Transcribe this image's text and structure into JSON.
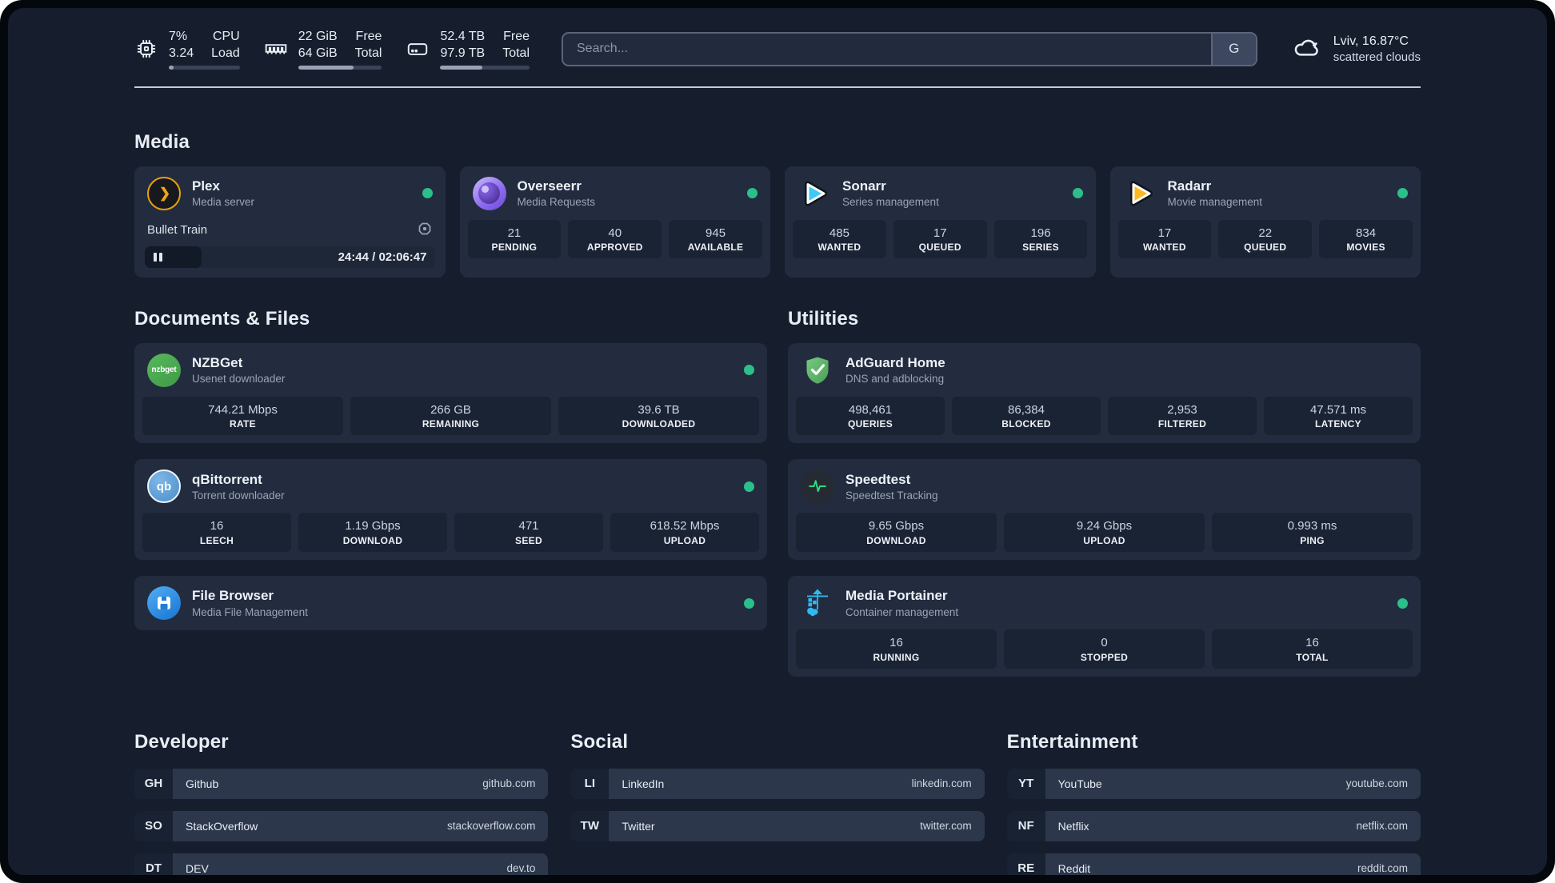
{
  "header": {
    "widgets": [
      {
        "values": [
          "7%",
          "3.24"
        ],
        "labels": [
          "CPU",
          "Load"
        ],
        "progress_pct": 7
      },
      {
        "values": [
          "22 GiB",
          "64 GiB"
        ],
        "labels": [
          "Free",
          "Total"
        ],
        "progress_pct": 66
      },
      {
        "values": [
          "52.4 TB",
          "97.9 TB"
        ],
        "labels": [
          "Free",
          "Total"
        ],
        "progress_pct": 47
      }
    ],
    "search": {
      "placeholder": "Search...",
      "provider_button": "G"
    },
    "weather": {
      "title": "Lviv, 16.87°C",
      "subtitle": "scattered clouds"
    }
  },
  "sections": {
    "media": {
      "title": "Media",
      "cards": {
        "plex": {
          "title": "Plex",
          "subtitle": "Media server",
          "online": true,
          "now_playing": {
            "title": "Bullet Train",
            "time": "24:44 / 02:06:47",
            "progress_pct": 19.5
          }
        },
        "overseerr": {
          "title": "Overseerr",
          "subtitle": "Media Requests",
          "online": true,
          "stats": [
            {
              "value": "21",
              "label": "PENDING"
            },
            {
              "value": "40",
              "label": "APPROVED"
            },
            {
              "value": "945",
              "label": "AVAILABLE"
            }
          ]
        },
        "sonarr": {
          "title": "Sonarr",
          "subtitle": "Series management",
          "online": true,
          "stats": [
            {
              "value": "485",
              "label": "WANTED"
            },
            {
              "value": "17",
              "label": "QUEUED"
            },
            {
              "value": "196",
              "label": "SERIES"
            }
          ]
        },
        "radarr": {
          "title": "Radarr",
          "subtitle": "Movie management",
          "online": true,
          "stats": [
            {
              "value": "17",
              "label": "WANTED"
            },
            {
              "value": "22",
              "label": "QUEUED"
            },
            {
              "value": "834",
              "label": "MOVIES"
            }
          ]
        }
      }
    },
    "documents": {
      "title": "Documents & Files",
      "cards": {
        "nzbget": {
          "title": "NZBGet",
          "subtitle": "Usenet downloader",
          "online": true,
          "stats": [
            {
              "value": "744.21 Mbps",
              "label": "RATE"
            },
            {
              "value": "266 GB",
              "label": "REMAINING"
            },
            {
              "value": "39.6 TB",
              "label": "DOWNLOADED"
            }
          ]
        },
        "qbittorrent": {
          "title": "qBittorrent",
          "subtitle": "Torrent downloader",
          "online": true,
          "stats": [
            {
              "value": "16",
              "label": "LEECH"
            },
            {
              "value": "1.19 Gbps",
              "label": "DOWNLOAD"
            },
            {
              "value": "471",
              "label": "SEED"
            },
            {
              "value": "618.52 Mbps",
              "label": "UPLOAD"
            }
          ]
        },
        "filebrowser": {
          "title": "File Browser",
          "subtitle": "Media File Management",
          "online": true
        }
      }
    },
    "utilities": {
      "title": "Utilities",
      "cards": {
        "adguard": {
          "title": "AdGuard Home",
          "subtitle": "DNS and adblocking",
          "stats": [
            {
              "value": "498,461",
              "label": "QUERIES"
            },
            {
              "value": "86,384",
              "label": "BLOCKED"
            },
            {
              "value": "2,953",
              "label": "FILTERED"
            },
            {
              "value": "47.571 ms",
              "label": "LATENCY"
            }
          ]
        },
        "speedtest": {
          "title": "Speedtest",
          "subtitle": "Speedtest Tracking",
          "stats": [
            {
              "value": "9.65 Gbps",
              "label": "DOWNLOAD"
            },
            {
              "value": "9.24 Gbps",
              "label": "UPLOAD"
            },
            {
              "value": "0.993 ms",
              "label": "PING"
            }
          ]
        },
        "portainer": {
          "title": "Media Portainer",
          "subtitle": "Container management",
          "online": true,
          "stats": [
            {
              "value": "16",
              "label": "RUNNING"
            },
            {
              "value": "0",
              "label": "STOPPED"
            },
            {
              "value": "16",
              "label": "TOTAL"
            }
          ]
        }
      }
    },
    "bookmarks": [
      {
        "title": "Developer",
        "links": [
          {
            "abbr": "GH",
            "name": "Github",
            "url": "github.com"
          },
          {
            "abbr": "SO",
            "name": "StackOverflow",
            "url": "stackoverflow.com"
          },
          {
            "abbr": "DT",
            "name": "DEV",
            "url": "dev.to"
          }
        ]
      },
      {
        "title": "Social",
        "links": [
          {
            "abbr": "LI",
            "name": "LinkedIn",
            "url": "linkedin.com"
          },
          {
            "abbr": "TW",
            "name": "Twitter",
            "url": "twitter.com"
          }
        ]
      },
      {
        "title": "Entertainment",
        "links": [
          {
            "abbr": "YT",
            "name": "YouTube",
            "url": "youtube.com"
          },
          {
            "abbr": "NF",
            "name": "Netflix",
            "url": "netflix.com"
          },
          {
            "abbr": "RE",
            "name": "Reddit",
            "url": "reddit.com"
          }
        ]
      }
    ]
  }
}
